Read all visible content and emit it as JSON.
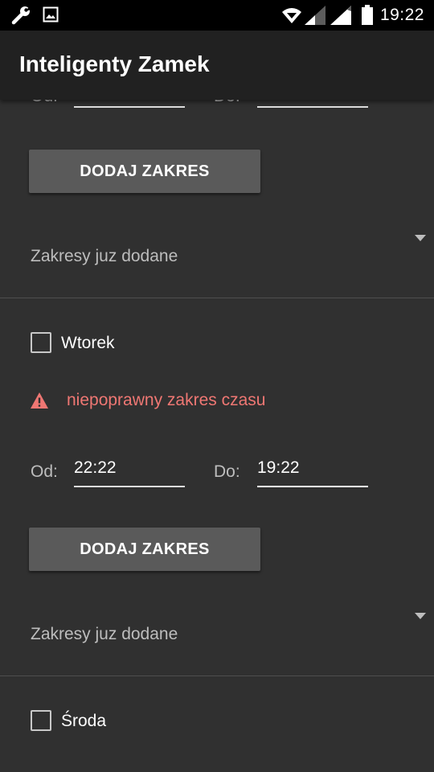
{
  "status_bar": {
    "time": "19:22",
    "icons": [
      "wrench-icon",
      "image-icon",
      "wifi-icon",
      "signal-icon",
      "signal-icon",
      "battery-icon"
    ]
  },
  "app_bar": {
    "title": "Inteligenty Zamek"
  },
  "top_section": {
    "from_label": "Od:",
    "to_label": "Do:",
    "add_button": "DODAJ ZAKRES",
    "ranges_spinner": "Zakresy juz dodane"
  },
  "tuesday": {
    "day_label": "Wtorek",
    "checked": false,
    "error": "niepoprawny zakres czasu",
    "from_label": "Od:",
    "from_value": "22:22",
    "to_label": "Do:",
    "to_value": "19:22",
    "add_button": "DODAJ ZAKRES",
    "ranges_spinner": "Zakresy juz dodane"
  },
  "wednesday": {
    "day_label": "Środa",
    "checked": false
  },
  "colors": {
    "background": "#303030",
    "app_bar": "#212121",
    "status_bar": "#000000",
    "button": "#5a5a5a",
    "error": "#ef7773"
  }
}
